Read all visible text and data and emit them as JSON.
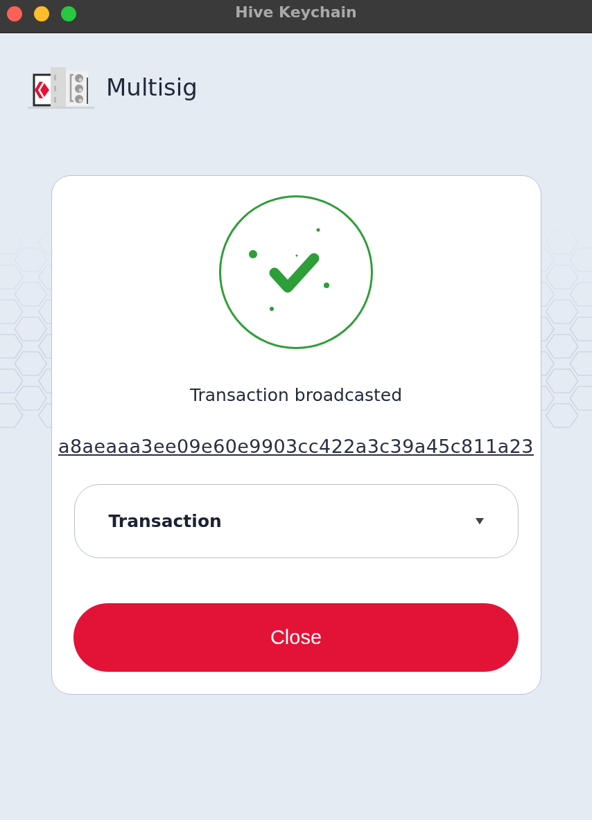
{
  "window": {
    "title": "Hive Keychain"
  },
  "header": {
    "title": "Multisig"
  },
  "result": {
    "kind": "success",
    "message": "Transaction broadcasted",
    "transaction_id": "a8aeaaa3ee09e60e9903cc422a3c39a45c811a23"
  },
  "details": {
    "label": "Transaction",
    "expanded": false
  },
  "buttons": [
    {
      "label": "Close",
      "kind": "primary"
    }
  ]
}
